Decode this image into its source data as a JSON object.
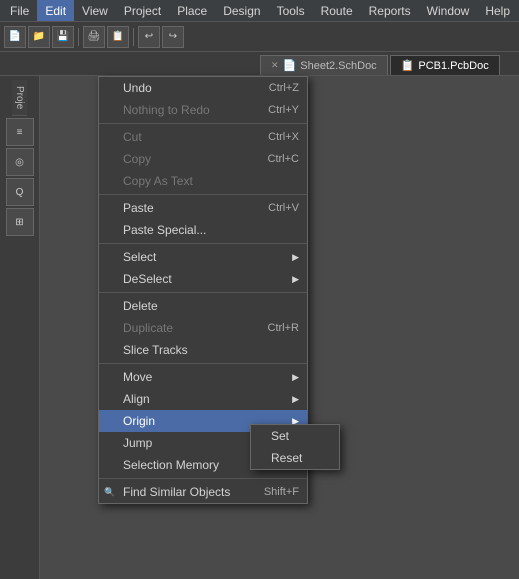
{
  "menubar": {
    "items": [
      {
        "label": "File",
        "id": "file"
      },
      {
        "label": "Edit",
        "id": "edit",
        "active": true
      },
      {
        "label": "View",
        "id": "view"
      },
      {
        "label": "Project",
        "id": "project"
      },
      {
        "label": "Place",
        "id": "place"
      },
      {
        "label": "Design",
        "id": "design"
      },
      {
        "label": "Tools",
        "id": "tools"
      },
      {
        "label": "Route",
        "id": "route"
      },
      {
        "label": "Reports",
        "id": "reports"
      },
      {
        "label": "Window",
        "id": "window"
      },
      {
        "label": "Help",
        "id": "help"
      }
    ]
  },
  "tabs": {
    "items": [
      {
        "label": "Sheet2.SchDoc",
        "icon": "📄",
        "active": false
      },
      {
        "label": "PCB1.PcbDoc",
        "icon": "📋",
        "active": true
      }
    ]
  },
  "edit_menu": {
    "items": [
      {
        "id": "undo",
        "label": "Undo",
        "shortcut": "Ctrl+Z",
        "disabled": false
      },
      {
        "id": "nothing-to-redo",
        "label": "Nothing to Redo",
        "shortcut": "Ctrl+Y",
        "disabled": true
      },
      {
        "id": "sep1",
        "type": "separator"
      },
      {
        "id": "cut",
        "label": "Cut",
        "shortcut": "Ctrl+X",
        "disabled": true
      },
      {
        "id": "copy",
        "label": "Copy",
        "shortcut": "Ctrl+C",
        "disabled": true
      },
      {
        "id": "copy-as-text",
        "label": "Copy As Text",
        "disabled": true
      },
      {
        "id": "sep2",
        "type": "separator"
      },
      {
        "id": "paste",
        "label": "Paste",
        "shortcut": "Ctrl+V",
        "disabled": false
      },
      {
        "id": "paste-special",
        "label": "Paste Special...",
        "disabled": false
      },
      {
        "id": "sep3",
        "type": "separator"
      },
      {
        "id": "select",
        "label": "Select",
        "hasArrow": true,
        "disabled": false
      },
      {
        "id": "deselect",
        "label": "DeSelect",
        "hasArrow": true,
        "disabled": false
      },
      {
        "id": "sep4",
        "type": "separator"
      },
      {
        "id": "delete",
        "label": "Delete",
        "disabled": false
      },
      {
        "id": "duplicate",
        "label": "Duplicate",
        "shortcut": "Ctrl+R",
        "disabled": true
      },
      {
        "id": "slice-tracks",
        "label": "Slice Tracks",
        "disabled": false
      },
      {
        "id": "sep5",
        "type": "separator"
      },
      {
        "id": "move",
        "label": "Move",
        "hasArrow": true,
        "disabled": false
      },
      {
        "id": "align",
        "label": "Align",
        "hasArrow": true,
        "disabled": false
      },
      {
        "id": "origin",
        "label": "Origin",
        "hasArrow": true,
        "disabled": false,
        "active": true
      },
      {
        "id": "jump",
        "label": "Jump",
        "hasArrow": true,
        "disabled": false
      },
      {
        "id": "selection-memory",
        "label": "Selection Memory",
        "hasArrow": true,
        "disabled": false
      },
      {
        "id": "sep6",
        "type": "separator"
      },
      {
        "id": "find-similar",
        "label": "Find Similar Objects",
        "shortcut": "Shift+F",
        "disabled": false
      }
    ]
  },
  "origin_submenu": {
    "items": [
      {
        "id": "set",
        "label": "Set",
        "active": false
      },
      {
        "id": "reset",
        "label": "Reset",
        "active": false
      }
    ]
  },
  "sidebar": {
    "buttons": [
      "≡",
      "◎",
      "Q",
      "⊞",
      "⊟",
      "▶"
    ]
  },
  "panel": {
    "title": "Proje"
  }
}
